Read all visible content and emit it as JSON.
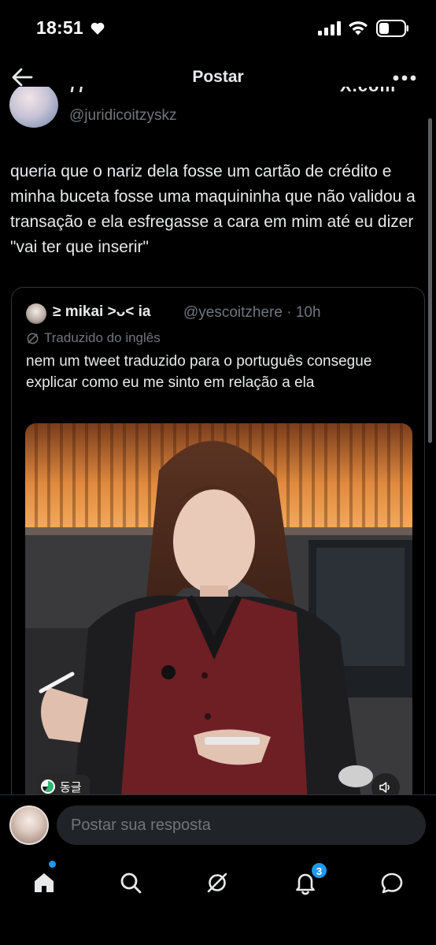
{
  "status_bar": {
    "time": "18:51",
    "icons": [
      "heart-icon",
      "signal-icon",
      "wifi-icon",
      "battery-icon"
    ]
  },
  "header": {
    "title": "Postar",
    "back_icon": "arrow-left-icon",
    "more_icon": "more-horizontal-icon"
  },
  "tweet": {
    "name_fragment": "ƒƒ",
    "cut_right_text": "X.com",
    "handle": "@juridicoitzyskz",
    "text": "queria que o nariz dela fosse um cartão de crédito e minha buceta fosse uma maquininha que não validou a transação e ela esfregasse a cara em mim até eu dizer \"vai ter que inserir\""
  },
  "quote": {
    "display_name": "≥ mikai >ᴗ< ia",
    "handle_time": "@yescoitzhere · 10h",
    "translated_label": "Traduzido do inglês",
    "text": "nem um tweet traduzido para o português consegue explicar como eu me sinto em relação a ela",
    "media": {
      "badge_label": "동글",
      "mute_icon": "volume-icon"
    }
  },
  "reply": {
    "placeholder": "Postar sua resposta"
  },
  "tabbar": {
    "items": [
      "home-icon",
      "search-icon",
      "grok-icon",
      "notifications-icon",
      "messages-icon"
    ],
    "notification_count": "3"
  },
  "colors": {
    "background": "#000000",
    "text": "#e7e9ea",
    "muted": "#71767b",
    "accent": "#1d9bf0",
    "border": "#2f3336"
  }
}
